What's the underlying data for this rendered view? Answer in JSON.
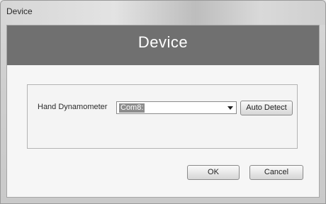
{
  "window": {
    "title": "Device"
  },
  "header": {
    "title": "Device"
  },
  "device_group": {
    "label": "Hand Dynamometer",
    "combo_value": "Com8:",
    "auto_detect_label": "Auto Detect"
  },
  "footer": {
    "ok_label": "OK",
    "cancel_label": "Cancel"
  },
  "colors": {
    "header_band": "#707070",
    "selection_highlight": "#8d8d8d"
  },
  "icons": {
    "combo_dropdown": "chevron-down-icon"
  }
}
